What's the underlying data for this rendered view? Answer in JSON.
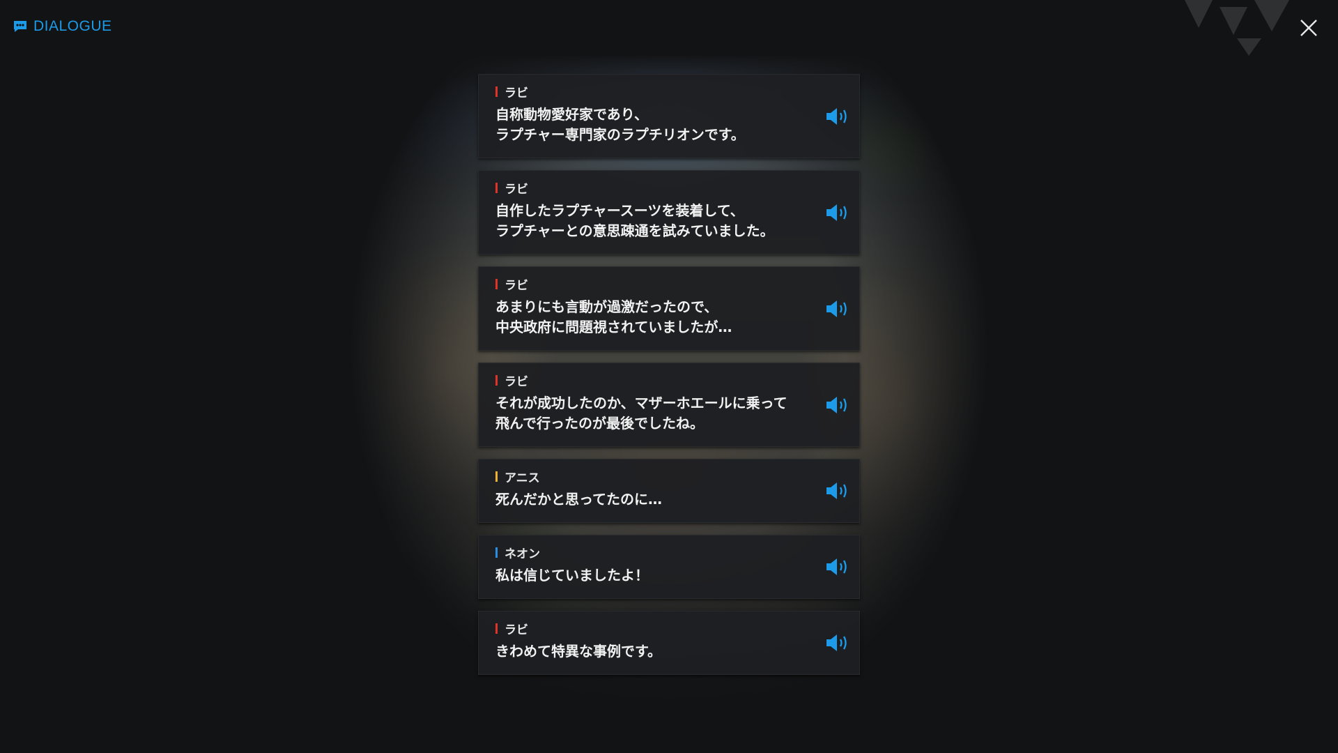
{
  "header": {
    "title": "DIALOGUE",
    "accent_color": "#1d9be8",
    "icon": "chat-bubble-icon"
  },
  "close": {
    "icon": "close-icon"
  },
  "dialogues": [
    {
      "speaker": "ラビ",
      "speaker_color": "#e0342a",
      "text": "自称動物愛好家であり、\nラプチャー専門家のラプチリオンです。",
      "voice_icon": "speaker-icon"
    },
    {
      "speaker": "ラビ",
      "speaker_color": "#e0342a",
      "text": "自作したラプチャースーツを装着して、\nラプチャーとの意思疎通を試みていました。",
      "voice_icon": "speaker-icon"
    },
    {
      "speaker": "ラビ",
      "speaker_color": "#e0342a",
      "text": "あまりにも言動が過激だったので、\n中央政府に問題視されていましたが…",
      "voice_icon": "speaker-icon"
    },
    {
      "speaker": "ラビ",
      "speaker_color": "#e0342a",
      "text": "それが成功したのか、マザーホエールに乗って\n飛んで行ったのが最後でしたね。",
      "voice_icon": "speaker-icon"
    },
    {
      "speaker": "アニス",
      "speaker_color": "#f0b233",
      "text": "死んだかと思ってたのに…",
      "voice_icon": "speaker-icon"
    },
    {
      "speaker": "ネオン",
      "speaker_color": "#2b8fe0",
      "text": "私は信じていましたよ！",
      "voice_icon": "speaker-icon"
    },
    {
      "speaker": "ラビ",
      "speaker_color": "#e0342a",
      "text": "きわめて特異な事例です。",
      "voice_icon": "speaker-icon"
    }
  ]
}
